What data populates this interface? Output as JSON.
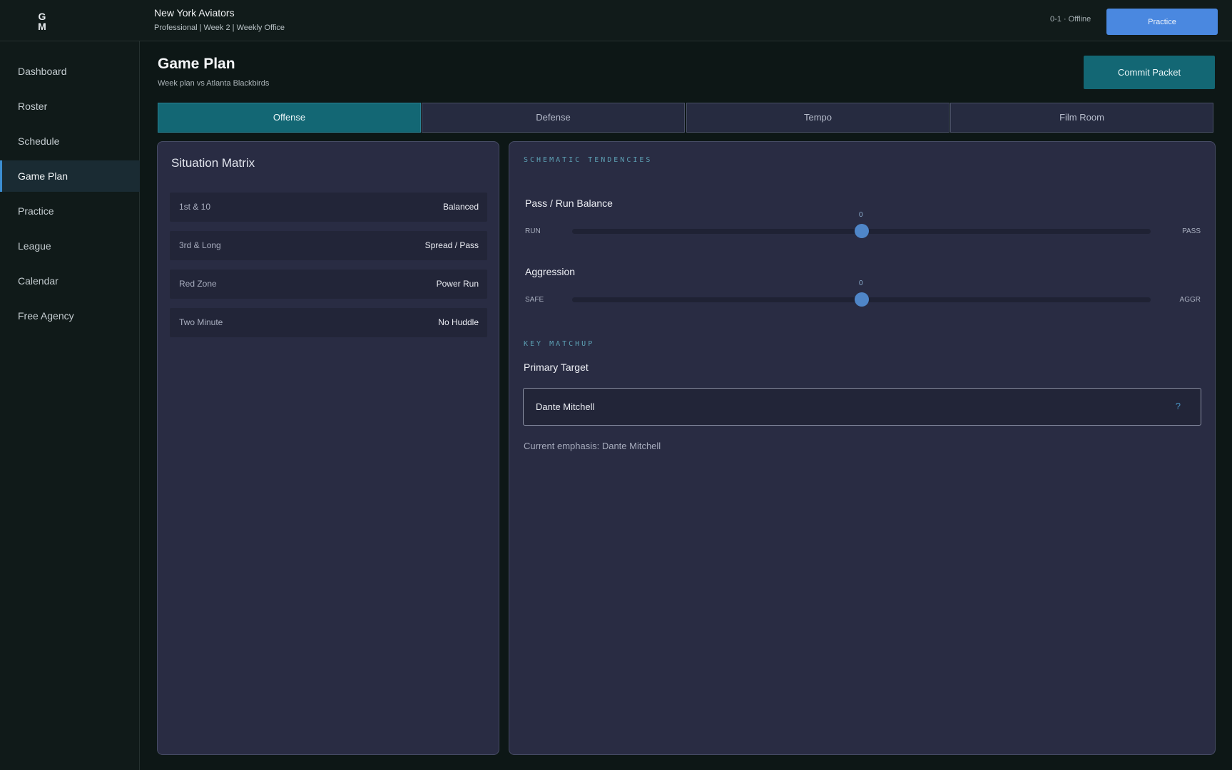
{
  "header": {
    "logo_text": "GM",
    "team_name": "New York Aviators",
    "subtitle": "Professional | Week 2 | Weekly Office",
    "record": "0-1 · Offline",
    "practice_button": "Practice"
  },
  "sidebar": {
    "items": [
      {
        "label": "Dashboard"
      },
      {
        "label": "Roster"
      },
      {
        "label": "Schedule"
      },
      {
        "label": "Game Plan",
        "active": true
      },
      {
        "label": "Practice"
      },
      {
        "label": "League"
      },
      {
        "label": "Calendar"
      },
      {
        "label": "Free Agency"
      }
    ]
  },
  "main": {
    "title": "Game Plan",
    "subtitle": "Week plan vs Atlanta Blackbirds",
    "commit_button": "Commit Packet",
    "tabs": [
      {
        "label": "Offense",
        "active": true
      },
      {
        "label": "Defense"
      },
      {
        "label": "Tempo"
      },
      {
        "label": "Film Room"
      }
    ],
    "situation_matrix": {
      "title": "Situation Matrix",
      "rows": [
        {
          "situation": "1st & 10",
          "call": "Balanced"
        },
        {
          "situation": "3rd & Long",
          "call": "Spread / Pass"
        },
        {
          "situation": "Red Zone",
          "call": "Power Run"
        },
        {
          "situation": "Two Minute",
          "call": "No Huddle"
        }
      ]
    },
    "tendencies": {
      "section_label": "SCHEMATIC TENDENCIES",
      "sliders": [
        {
          "title": "Pass / Run Balance",
          "value": "0",
          "min_label": "RUN",
          "max_label": "PASS",
          "level": 0.5
        },
        {
          "title": "Aggression",
          "value": "0",
          "min_label": "SAFE",
          "max_label": "AGGR",
          "level": 0.5
        }
      ]
    },
    "matchup": {
      "section_label": "KEY MATCHUP",
      "primary_label": "Primary Target",
      "selected": "Dante Mitchell",
      "select_icon": "?",
      "emphasis": "Current emphasis: Dante Mitchell"
    }
  },
  "colors": {
    "accent": "#136774",
    "primary_button": "#4a88e0",
    "slider_thumb": "#4f86c8"
  }
}
